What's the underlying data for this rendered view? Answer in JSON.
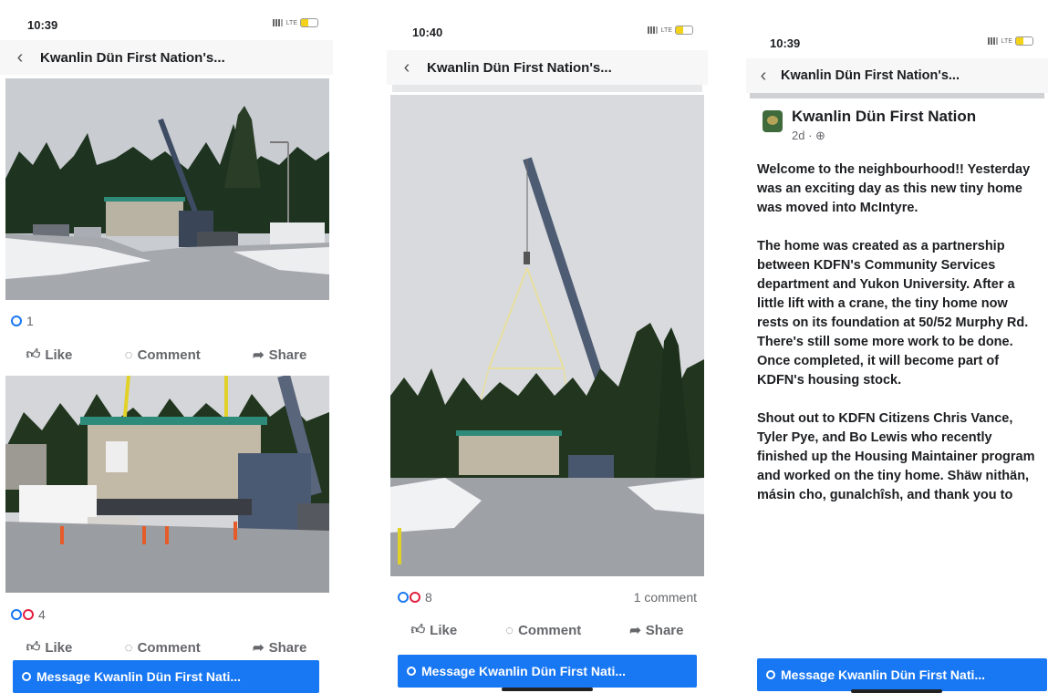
{
  "screens": [
    {
      "time": "10:39",
      "network": "LTE",
      "nav_title": "Kwanlin Dün First Nation's...",
      "posts": [
        {
          "reaction_count": "1",
          "reactions": [
            "like"
          ]
        },
        {
          "reaction_count": "4",
          "reactions": [
            "like",
            "love"
          ]
        }
      ],
      "actions": {
        "like": "Like",
        "comment": "Comment",
        "share": "Share"
      },
      "message_button": "Message Kwanlin Dün First Nati..."
    },
    {
      "time": "10:40",
      "network": "LTE",
      "nav_title": "Kwanlin Dün First Nation's...",
      "reaction_count": "8",
      "comment_count": "1 comment",
      "actions": {
        "like": "Like",
        "comment": "Comment",
        "share": "Share"
      },
      "message_button": "Message Kwanlin Dün First Nati..."
    },
    {
      "time": "10:39",
      "network": "LTE",
      "nav_title": "Kwanlin Dün First Nation's...",
      "page_name": "Kwanlin Dün First Nation",
      "post_time": "2d · ⊕",
      "paragraphs": [
        "Welcome to the neighbourhood!! Yesterday was an exciting day as this new tiny home was moved into McIntyre.",
        "The home was created as a partnership between KDFN's Community Services department and Yukon University. After a little lift with a crane, the tiny home now rests on its foundation at 50/52 Murphy Rd. There's still some more work to be done. Once completed, it will become part of KDFN's housing stock.",
        "Shout out to KDFN Citizens Chris Vance, Tyler Pye, and Bo Lewis who recently finished up the Housing Maintainer program and worked on the tiny home. Shäw nithän, másin cho, gunalchîsh, and thank you to"
      ],
      "message_button": "Message Kwanlin Dün First Nati..."
    }
  ],
  "colors": {
    "facebook_blue": "#1877f2",
    "love_red": "#e41e3f",
    "trailer_roof": "#2e8b7a"
  },
  "icons": {
    "like": "thumbs-up-icon",
    "comment": "comment-bubble-icon",
    "share": "share-arrow-icon",
    "back": "chevron-left-icon",
    "messenger": "messenger-icon"
  }
}
